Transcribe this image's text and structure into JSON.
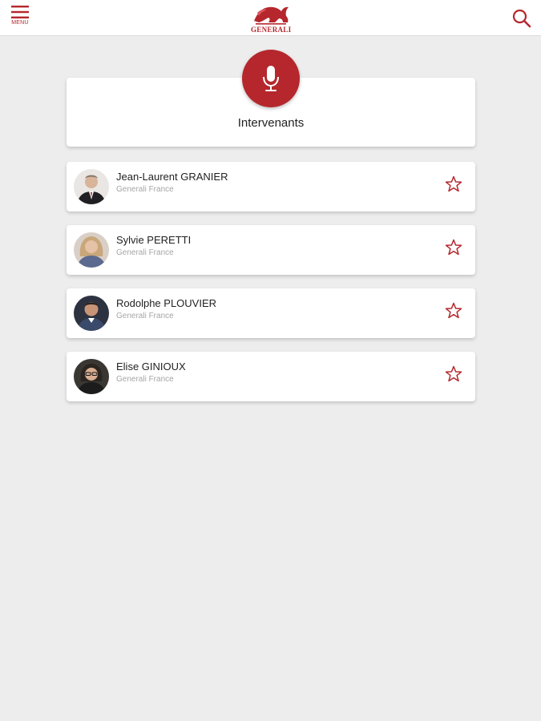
{
  "topbar": {
    "menu_label": "MENU",
    "logo_text": "GENERALI",
    "menu_icon": "hamburger-icon",
    "search_icon": "search-icon",
    "accent_color": "#b5272d"
  },
  "header": {
    "icon": "microphone-icon",
    "title": "Intervenants"
  },
  "speakers": [
    {
      "name": "Jean-Laurent GRANIER",
      "company": "Generali France",
      "favorite_icon": "star-outline-icon"
    },
    {
      "name": "Sylvie PERETTI",
      "company": "Generali France",
      "favorite_icon": "star-outline-icon"
    },
    {
      "name": "Rodolphe PLOUVIER",
      "company": "Generali France",
      "favorite_icon": "star-outline-icon"
    },
    {
      "name": "Elise GINIOUX",
      "company": "Generali France",
      "favorite_icon": "star-outline-icon"
    }
  ]
}
